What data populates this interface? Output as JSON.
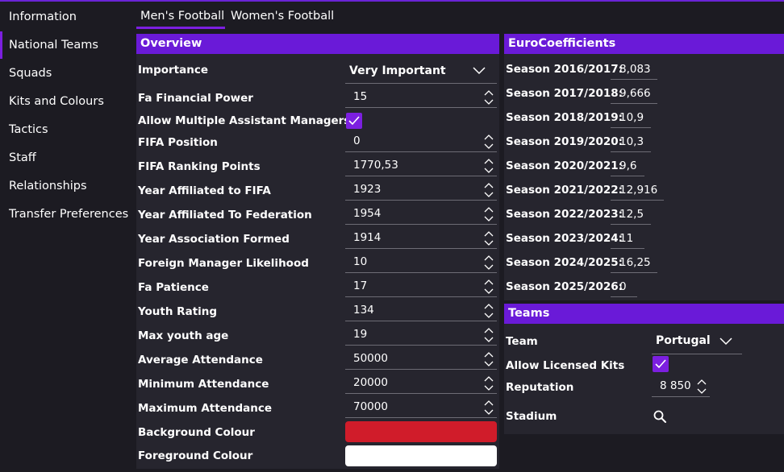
{
  "sidebar": {
    "items": [
      {
        "label": "Information"
      },
      {
        "label": "National Teams"
      },
      {
        "label": "Squads"
      },
      {
        "label": "Kits and Colours"
      },
      {
        "label": "Tactics"
      },
      {
        "label": "Staff"
      },
      {
        "label": "Relationships"
      },
      {
        "label": "Transfer Preferences"
      }
    ],
    "active_index": 1
  },
  "tabs": [
    {
      "label": "Men's Football",
      "active": true
    },
    {
      "label": "Women's Football",
      "active": false
    }
  ],
  "overview": {
    "title": "Overview",
    "importance": {
      "label": "Importance",
      "value": "Very Important"
    },
    "fa_financial_power": {
      "label": "Fa Financial Power",
      "value": "15"
    },
    "allow_multiple_assistant_managers": {
      "label": "Allow Multiple Assistant Managers",
      "checked": true
    },
    "fifa_position": {
      "label": "FIFA Position",
      "value": "0"
    },
    "fifa_ranking_points": {
      "label": "FIFA Ranking Points",
      "value": "1770,53"
    },
    "year_affiliated_fifa": {
      "label": "Year Affiliated to FIFA",
      "value": "1923"
    },
    "year_affiliated_federation": {
      "label": "Year Affiliated To Federation",
      "value": "1954"
    },
    "year_association_formed": {
      "label": "Year Association Formed",
      "value": "1914"
    },
    "foreign_manager_likelihood": {
      "label": "Foreign Manager Likelihood",
      "value": "10"
    },
    "fa_patience": {
      "label": "Fa Patience",
      "value": "17"
    },
    "youth_rating": {
      "label": "Youth Rating",
      "value": "134"
    },
    "max_youth_age": {
      "label": "Max youth age",
      "value": "19"
    },
    "average_attendance": {
      "label": "Average Attendance",
      "value": "50000"
    },
    "minimum_attendance": {
      "label": "Minimum Attendance",
      "value": "20000"
    },
    "maximum_attendance": {
      "label": "Maximum Attendance",
      "value": "70000"
    },
    "background_colour": {
      "label": "Background Colour",
      "color": "#d01c2a"
    },
    "foreground_colour": {
      "label": "Foreground Colour",
      "color": "#ffffff"
    }
  },
  "euro": {
    "title": "EuroCoefficients",
    "seasons": [
      {
        "label": "Season 2016/2017:",
        "value": "8,083"
      },
      {
        "label": "Season 2017/2018:",
        "value": "9,666"
      },
      {
        "label": "Season 2018/2019:",
        "value": "10,9"
      },
      {
        "label": "Season 2019/2020:",
        "value": "10,3"
      },
      {
        "label": "Season 2020/2021:",
        "value": "9,6"
      },
      {
        "label": "Season 2021/2022:",
        "value": "12,916"
      },
      {
        "label": "Season 2022/2023:",
        "value": "12,5"
      },
      {
        "label": "Season 2023/2024:",
        "value": "11"
      },
      {
        "label": "Season 2024/2025:",
        "value": "16,25"
      },
      {
        "label": "Season 2025/2026:",
        "value": "0"
      }
    ]
  },
  "teams": {
    "title": "Teams",
    "team": {
      "label": "Team",
      "value": "Portugal"
    },
    "allow_licensed_kits": {
      "label": "Allow Licensed Kits",
      "checked": true
    },
    "reputation": {
      "label": "Reputation",
      "value": "8 850"
    },
    "stadium": {
      "label": "Stadium",
      "icon": "search-icon"
    }
  },
  "colors": {
    "accent": "#6a1ad8",
    "background": "#1c1b22",
    "panel": "#26252e"
  }
}
